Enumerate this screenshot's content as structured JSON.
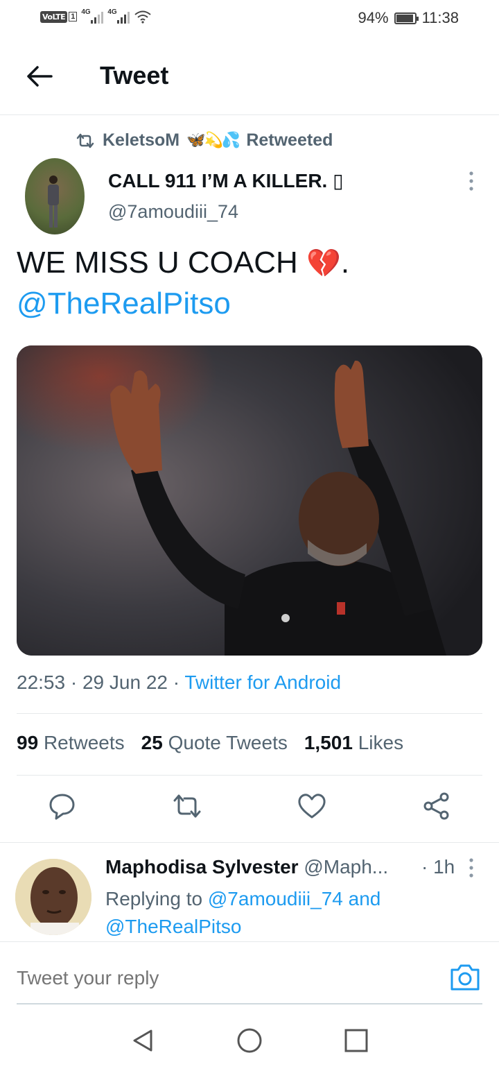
{
  "status_bar": {
    "volte": "VoLTE",
    "sim": "1",
    "network1": "4G",
    "network2": "4G",
    "battery_percent": "94%",
    "battery_level": 0.94,
    "time": "11:38"
  },
  "header": {
    "back_icon": "arrow-left-icon",
    "title": "Tweet"
  },
  "retweet_context": {
    "user": "KeletsoM",
    "emojis": "🦋💫💦",
    "suffix": "Retweeted"
  },
  "tweet": {
    "author_name": "CALL 911 I’M A KILLER. ▯",
    "author_handle": "@7amoudiii_74",
    "text": "WE MISS U COACH ",
    "emoji": "💔",
    "text_end": ".",
    "mention": "@TheRealPitso",
    "time": "22:53",
    "date": "29 Jun 22",
    "source": "Twitter for Android",
    "media_alt": "photo"
  },
  "stats": {
    "retweets_count": "99",
    "retweets_label": "Retweets",
    "quotes_count": "25",
    "quotes_label": "Quote Tweets",
    "likes_count": "1,501",
    "likes_label": "Likes"
  },
  "actions": [
    "reply-icon",
    "retweet-icon",
    "like-icon",
    "share-icon"
  ],
  "reply": {
    "name": "Maphodisa Sylvester",
    "handle": "@Maph...",
    "time": "· 1h",
    "replying_prefix": "Replying to",
    "mention1": "@7amoudiii_74",
    "and": "and",
    "mention2": "@TheRealPitso"
  },
  "composer": {
    "placeholder": "Tweet your reply",
    "camera_icon": "camera-icon"
  },
  "colors": {
    "accent": "#1d9bf0",
    "text": "#0f1419",
    "secondary": "#536471",
    "divider": "#e6e9eb"
  }
}
